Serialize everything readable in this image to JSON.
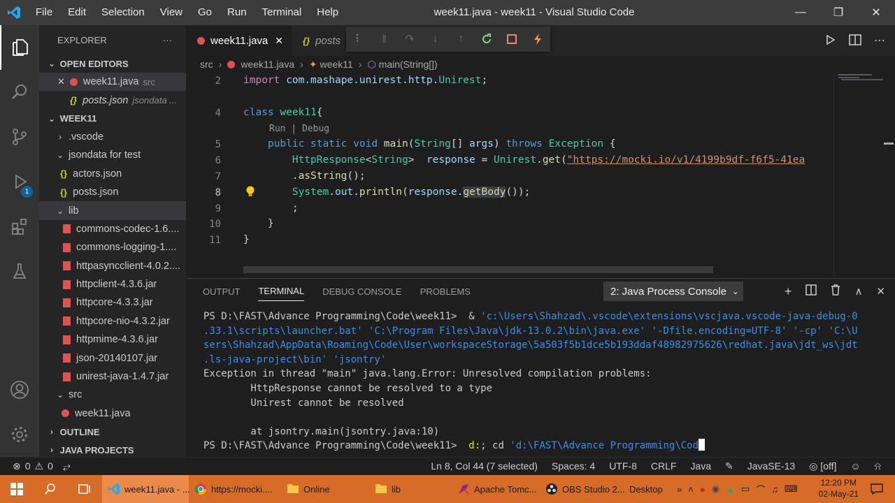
{
  "titlebar": {
    "menu": [
      "File",
      "Edit",
      "Selection",
      "View",
      "Go",
      "Run",
      "Terminal",
      "Help"
    ],
    "title": "week11.java - week11 - Visual Studio Code"
  },
  "activity": {
    "debug_badge": "1"
  },
  "sidebar": {
    "header": "EXPLORER",
    "more": "···",
    "open_editors": {
      "label": "OPEN EDITORS",
      "items": [
        {
          "name": "week11.java",
          "desc": "src"
        },
        {
          "name": "posts.json",
          "desc": "jsondata ..."
        }
      ]
    },
    "project": {
      "label": "WEEK11",
      "items": [
        {
          "name": ".vscode"
        },
        {
          "name": "jsondata for test"
        },
        {
          "name": "actors.json"
        },
        {
          "name": "posts.json"
        },
        {
          "name": "lib"
        },
        {
          "name": "commons-codec-1.6...."
        },
        {
          "name": "commons-logging-1...."
        },
        {
          "name": "httpasyncclient-4.0.2...."
        },
        {
          "name": "httpclient-4.3.6.jar"
        },
        {
          "name": "httpcore-4.3.3.jar"
        },
        {
          "name": "httpcore-nio-4.3.2.jar"
        },
        {
          "name": "httpmime-4.3.6.jar"
        },
        {
          "name": "json-20140107.jar"
        },
        {
          "name": "unirest-java-1.4.7.jar"
        },
        {
          "name": "src"
        },
        {
          "name": "week11.java"
        }
      ]
    },
    "outline": "OUTLINE",
    "java_projects": "JAVA PROJECTS"
  },
  "tabs": [
    {
      "label": "week11.java",
      "close": "✕"
    },
    {
      "label": "posts"
    }
  ],
  "breadcrumb": [
    "src",
    "week11.java",
    "week11",
    "main(String[])"
  ],
  "code": {
    "line_numbers": [
      "2",
      "4",
      "5",
      "6",
      "7",
      "8",
      "9",
      "10",
      "11"
    ],
    "codelens": "Run | Debug",
    "l2": {
      "kw": "import",
      "pkg": "com.mashape.unirest.http.",
      "cls": "Unirest",
      "end": ";"
    },
    "l4": {
      "kw": "class",
      "cls": "week11",
      "end": "{"
    },
    "l5": {
      "mod": "public static void",
      "fn": "main",
      "p1": "(",
      "ty": "String",
      "p2": "[] ",
      "arg": "args",
      "p3": ") ",
      "throws": "throws",
      "ex": "Exception",
      "end": " {"
    },
    "l6": {
      "ty": "HttpResponse",
      "lt": "<",
      "ty2": "String",
      "gt": ">  ",
      "var": "response",
      "eq": " = ",
      "cls": "Unirest",
      "dot": ".",
      "fn": "get",
      "p": "(",
      "url": "\"https://mocki.io/v1/4199b9df-f6f5-41ea"
    },
    "l7": {
      "dot": ".",
      "fn": "asString",
      "end": "();"
    },
    "l8": {
      "cls": "System",
      "dot1": ".",
      "out": "out",
      "dot2": ".",
      "fn": "println",
      "p": "(",
      "var": "response",
      "dot3": ".",
      "sel": "getBody",
      "end": "());"
    },
    "l9": ";",
    "l10": "}",
    "l11": "}"
  },
  "panel": {
    "tabs": [
      "OUTPUT",
      "TERMINAL",
      "DEBUG CONSOLE",
      "PROBLEMS"
    ],
    "console_select": "2: Java Process Console",
    "terminal": {
      "prompt1": "PS D:\\FAST\\Advance Programming\\Code\\week11>  & ",
      "cmd1": "'c:\\Users\\Shahzad\\.vscode\\extensions\\vscjava.vscode-java-debug-0",
      "cmd2": ".33.1\\scripts\\launcher.bat' 'C:\\Program Files\\Java\\jdk-13.0.2\\bin\\java.exe' '-Dfile.encoding=UTF-8' '-cp' 'C:\\U",
      "cmd3": "sers\\Shahzad\\AppData\\Roaming\\Code\\User\\workspaceStorage\\5a503f5b1dce5b193ddaf48982975626\\redhat.java\\jdt_ws\\jdt",
      "cmd4": ".ls-java-project\\bin' 'jsontry'",
      "err1": "Exception in thread \"main\" java.lang.Error: Unresolved compilation problems:",
      "err2": "        HttpResponse cannot be resolved to a type",
      "err3": "        Unirest cannot be resolved",
      "err4": "        at jsontry.main(jsontry.java:10)",
      "prompt2": "PS D:\\FAST\\Advance Programming\\Code\\week11>  ",
      "cmd5a": "d:",
      "cmd5b": "; cd ",
      "cmd5c": "'d:\\FAST\\Advance Programming\\Cod"
    }
  },
  "status": {
    "errors": "0",
    "warnings": "0",
    "position": "Ln 8, Col 44 (7 selected)",
    "spaces": "Spaces: 4",
    "encoding": "UTF-8",
    "eol": "CRLF",
    "language": "Java",
    "jdk": "JavaSE-13",
    "live": "[off]"
  },
  "taskbar": {
    "items": [
      "week11.java - ...",
      "https://mocki....",
      "Online",
      "lib",
      "Apache Tomc...",
      "OBS Studio 2...",
      "Desktop"
    ],
    "time": "12:20 PM",
    "date": "02-May-21"
  },
  "colors": {
    "accent": "#007acc",
    "taskbar": "#d76c28",
    "error_icon": "#e05252"
  }
}
